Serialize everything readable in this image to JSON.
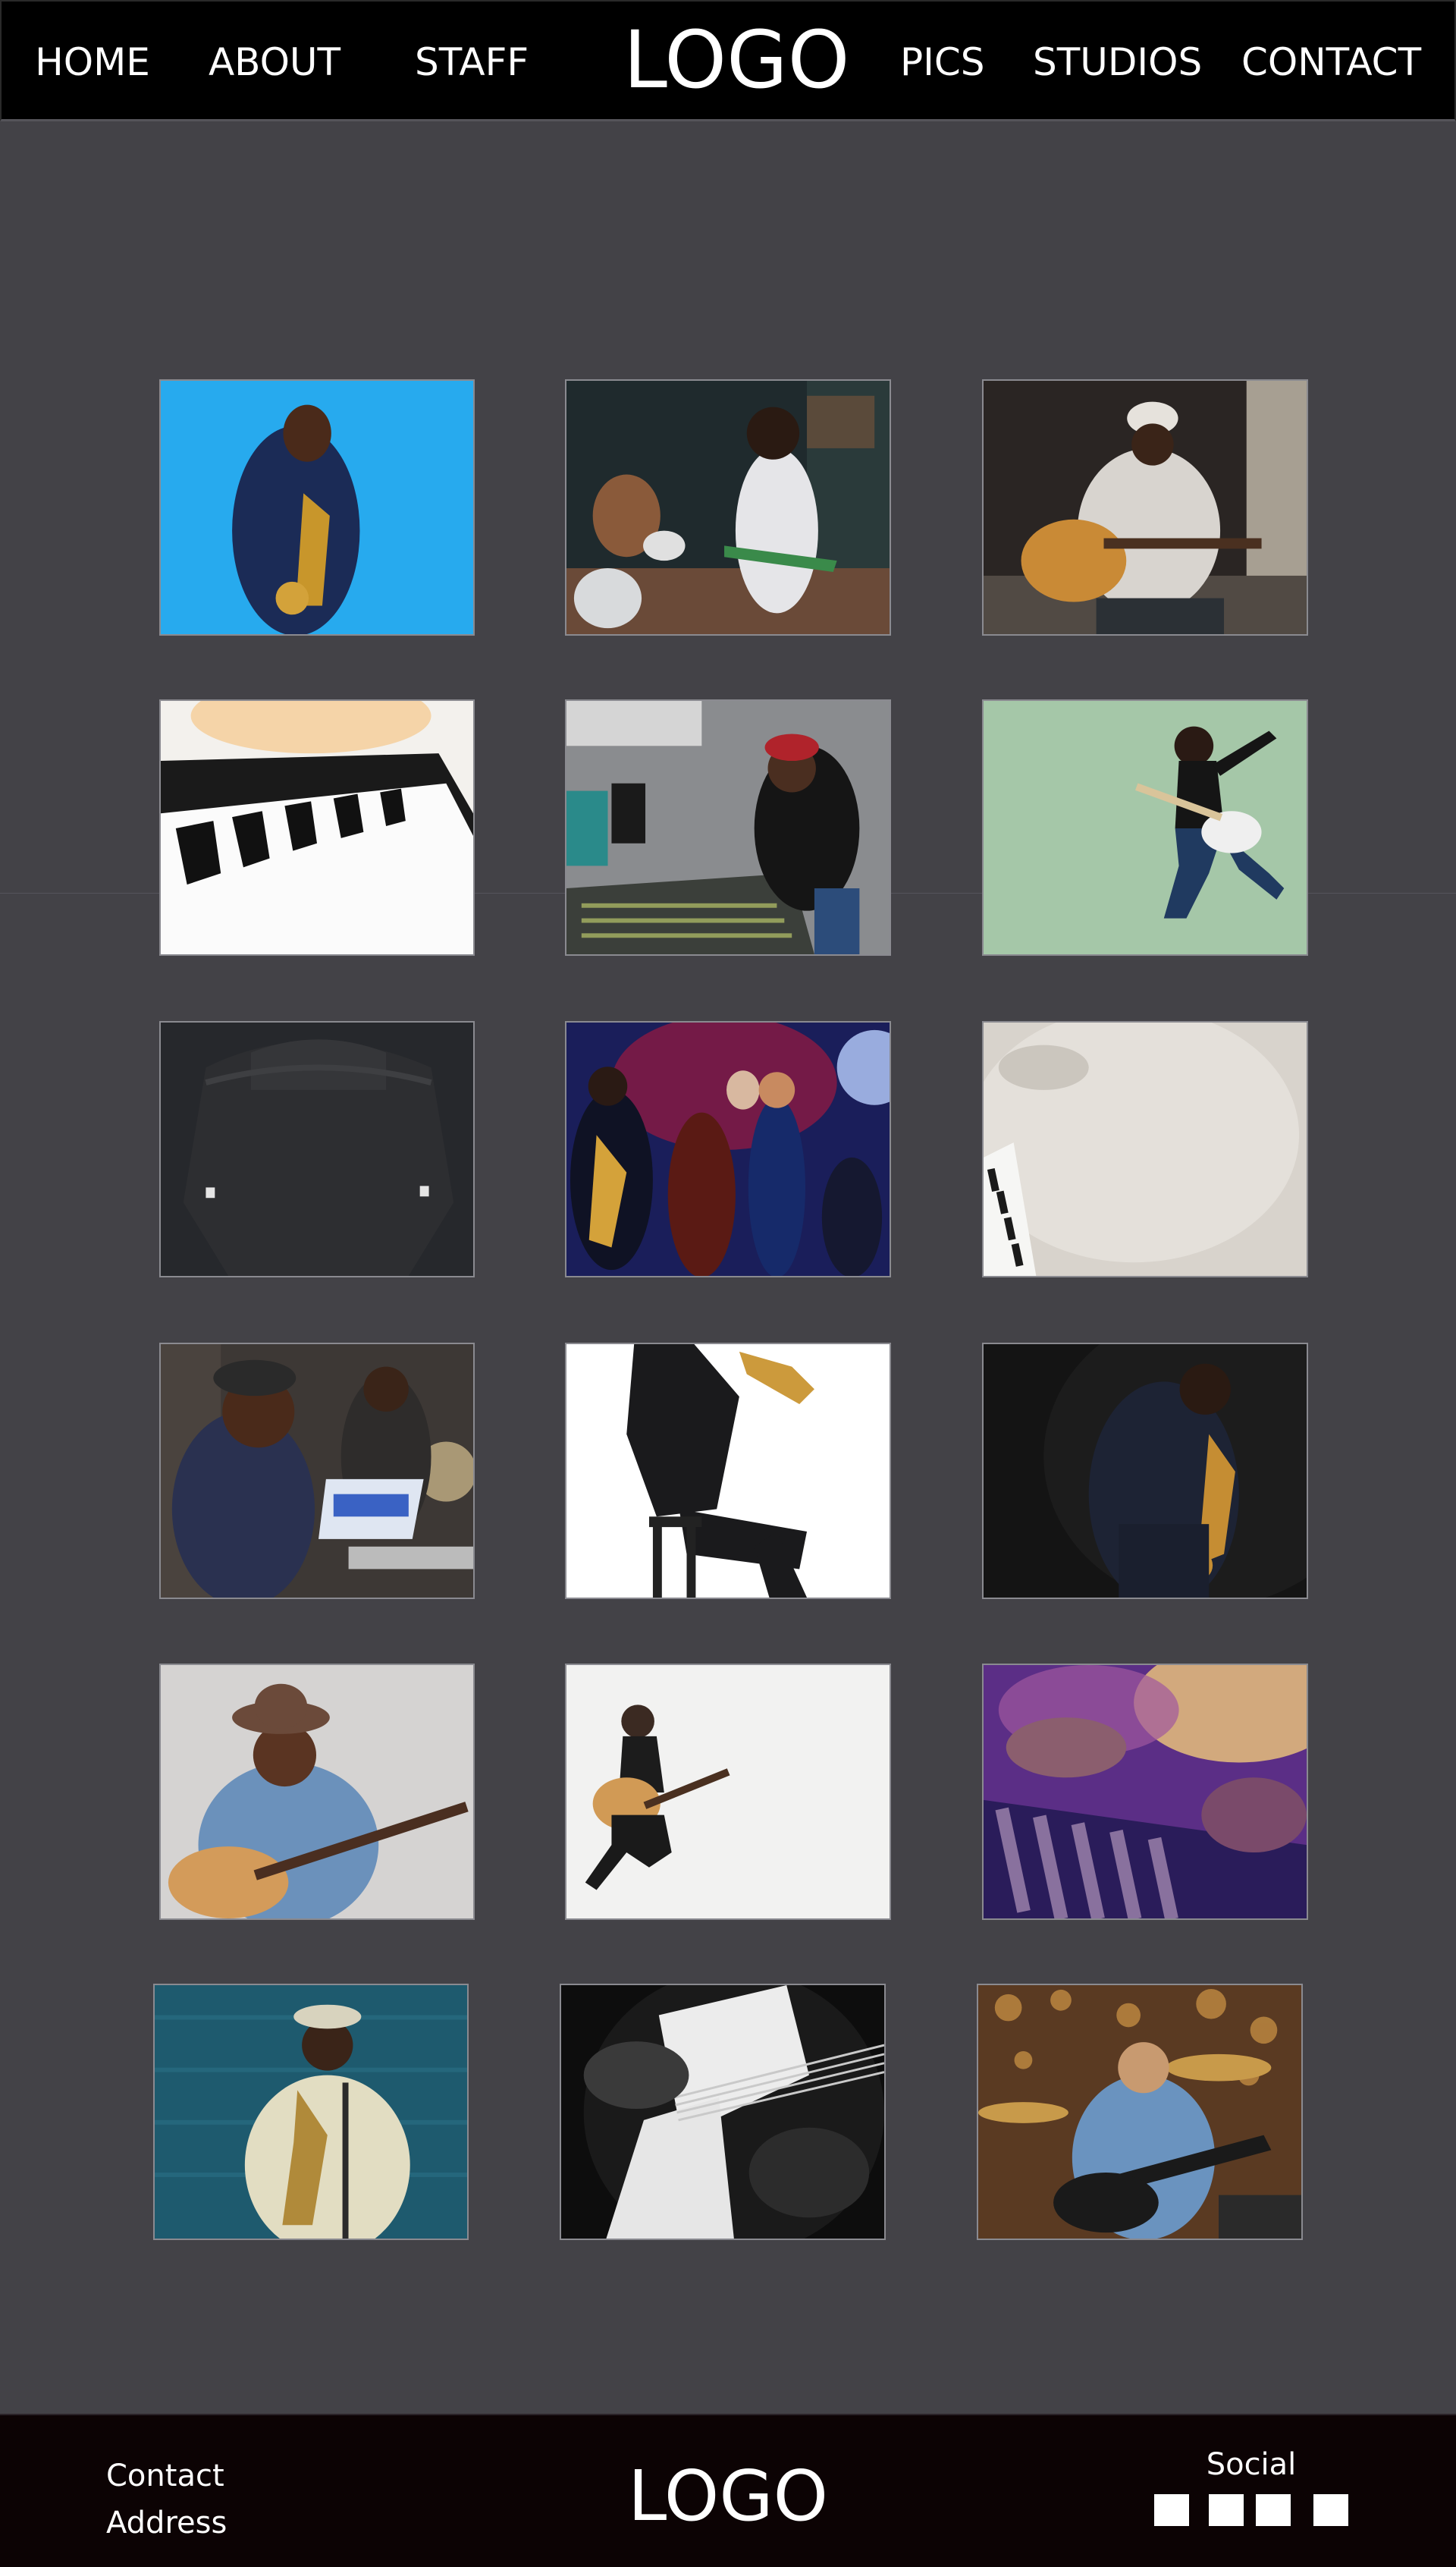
{
  "header": {
    "nav_left": [
      "HOME",
      "ABOUT",
      "STAFF"
    ],
    "logo": "LOGO",
    "nav_right": [
      "PICS",
      "STUDIOS",
      "CONTACT"
    ]
  },
  "gallery": {
    "photos": [
      {
        "subject": "saxophonist-blue-background"
      },
      {
        "subject": "band-with-drummer-and-guitarist"
      },
      {
        "subject": "acoustic-guitarist-in-hat"
      },
      {
        "subject": "piano-keys-closeup"
      },
      {
        "subject": "producer-at-mixing-console"
      },
      {
        "subject": "jumping-electric-guitarist"
      },
      {
        "subject": "dark-shirt-back-view"
      },
      {
        "subject": "jazz-band-on-stage"
      },
      {
        "subject": "piano-keys-on-concrete"
      },
      {
        "subject": "producer-with-laptop-and-singer"
      },
      {
        "subject": "saxophonist-on-stool"
      },
      {
        "subject": "saxophonist-in-dark-suit"
      },
      {
        "subject": "guitarist-in-brown-hat"
      },
      {
        "subject": "jumping-acoustic-guitarist"
      },
      {
        "subject": "hands-on-purple-keys"
      },
      {
        "subject": "saxophonist-wooden-wall"
      },
      {
        "subject": "bass-guitar-closeup"
      },
      {
        "subject": "guitarist-with-drums-bokeh"
      }
    ]
  },
  "footer": {
    "contact": "Contact",
    "address": "Address",
    "logo": "LOGO",
    "social_label": "Social",
    "social_count": 4
  },
  "colors": {
    "page_background": "#434247",
    "header_background": "#000000",
    "footer_background": "#0c0304",
    "text": "#ffffff"
  }
}
